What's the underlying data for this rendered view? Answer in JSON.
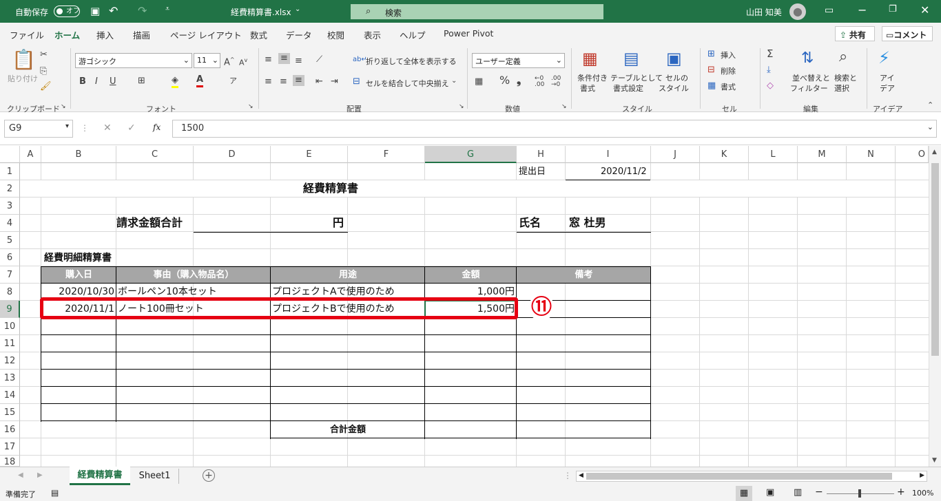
{
  "titlebar": {
    "autosave": "自動保存",
    "toggle": "オフ",
    "filename": "経費精算書.xlsx",
    "search": "検索",
    "user": "山田 知美"
  },
  "menu": [
    "ファイル",
    "ホーム",
    "挿入",
    "描画",
    "ページ レイアウト",
    "数式",
    "データ",
    "校閲",
    "表示",
    "ヘルプ",
    "Power Pivot"
  ],
  "share": "共有",
  "comment": "コメント",
  "ribbon": {
    "paste": "貼り付け",
    "clipboard": "クリップボード",
    "font_name": "游ゴシック",
    "font_size": "11",
    "font": "フォント",
    "wrap": "折り返して全体を表示する",
    "merge": "セルを結合して中央揃え",
    "alignment": "配置",
    "number_format": "ユーザー定義",
    "number": "数値",
    "cond1": "条件付き",
    "cond2": "書式",
    "table1": "テーブルとして",
    "table2": "書式設定",
    "cellstyle1": "セルの",
    "cellstyle2": "スタイル",
    "styles": "スタイル",
    "insert": "挿入",
    "delete": "削除",
    "format": "書式",
    "cells": "セル",
    "sort1": "並べ替えと",
    "sort2": "フィルター",
    "find1": "検索と",
    "find2": "選択",
    "editing": "編集",
    "ideas1": "アイ",
    "ideas2": "デア",
    "ideas_group": "アイデア"
  },
  "formula": {
    "namebox": "G9",
    "fx": "fx",
    "value": "1500"
  },
  "columns": [
    "A",
    "B",
    "C",
    "D",
    "E",
    "F",
    "G",
    "H",
    "I",
    "J",
    "K",
    "L",
    "M",
    "N",
    "O"
  ],
  "rows": [
    "1",
    "2",
    "3",
    "4",
    "5",
    "6",
    "7",
    "8",
    "9",
    "10",
    "11",
    "12",
    "13",
    "14",
    "15",
    "16",
    "17",
    "18"
  ],
  "sheet": {
    "submit_label": "提出日",
    "submit_date": "2020/11/2",
    "title": "経費精算書",
    "total_label": "請求金額合計",
    "yen": "円",
    "name_label": "氏名",
    "name": "窓 杜男",
    "detail_title": "経費明細精算書",
    "headers": [
      "購入日",
      "事由（購入物品名）",
      "用途",
      "金額",
      "備考"
    ],
    "rows": [
      [
        "2020/10/30",
        "ボールペン10本セット",
        "プロジェクトAで使用のため",
        "1,000円"
      ],
      [
        "2020/11/1",
        "ノート100冊セット",
        "プロジェクトBで使用のため",
        "1,500円"
      ]
    ],
    "sum_label": "合計金額"
  },
  "annotation": "⑪",
  "tabs": [
    "経費精算書",
    "Sheet1"
  ],
  "status": {
    "ready": "準備完了",
    "zoom": "100%"
  },
  "colors": {
    "accent": "#217346",
    "highlight": "#e60012",
    "header": "#a6a6a6"
  }
}
